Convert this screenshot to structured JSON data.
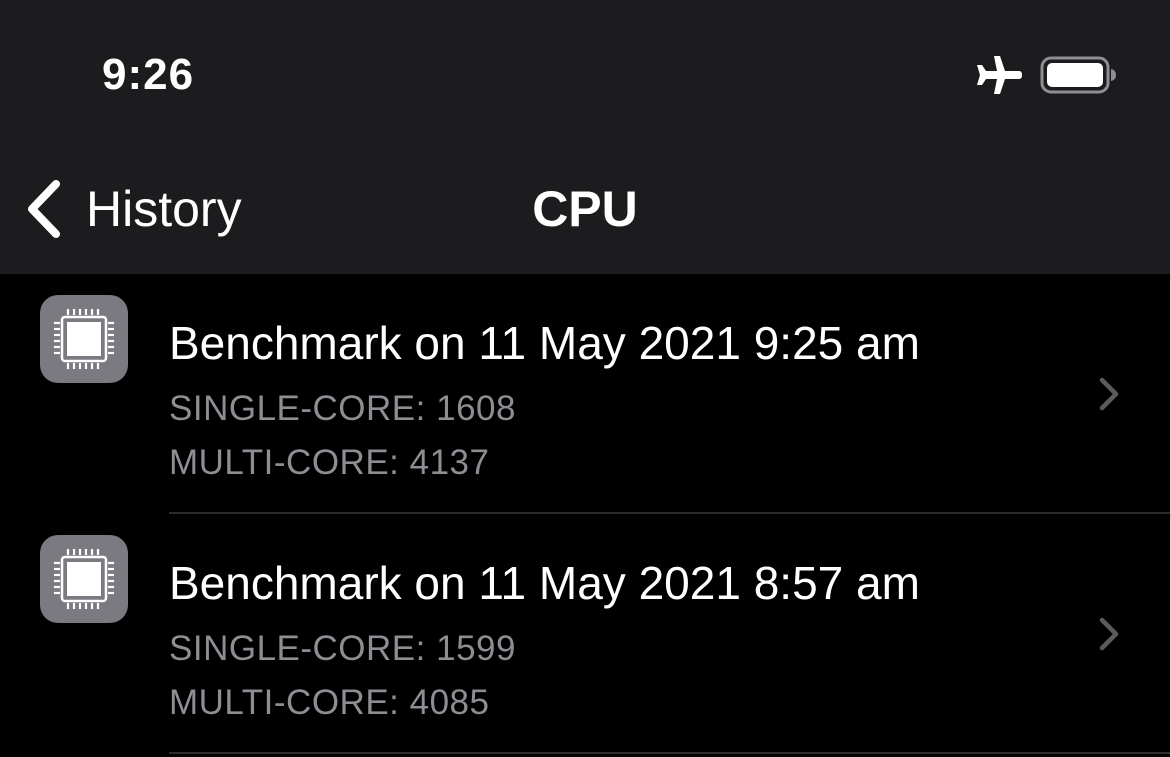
{
  "status_bar": {
    "time": "9:26",
    "icons": [
      "airplane-icon",
      "battery-icon"
    ]
  },
  "nav": {
    "back_label": "History",
    "title": "CPU"
  },
  "benchmarks": [
    {
      "title": "Benchmark on 11 May 2021 9:25 am",
      "single_core": "SINGLE-CORE: 1608",
      "multi_core": "MULTI-CORE: 4137",
      "icon": "cpu-chip-icon"
    },
    {
      "title": "Benchmark on 11 May 2021 8:57 am",
      "single_core": "SINGLE-CORE: 1599",
      "multi_core": "MULTI-CORE: 4085",
      "icon": "cpu-chip-icon"
    }
  ],
  "colors": {
    "bar_background": "#1c1c1e",
    "list_background": "#000000",
    "secondary_text": "#8d8d93",
    "icon_tile": "#7a7a80"
  }
}
